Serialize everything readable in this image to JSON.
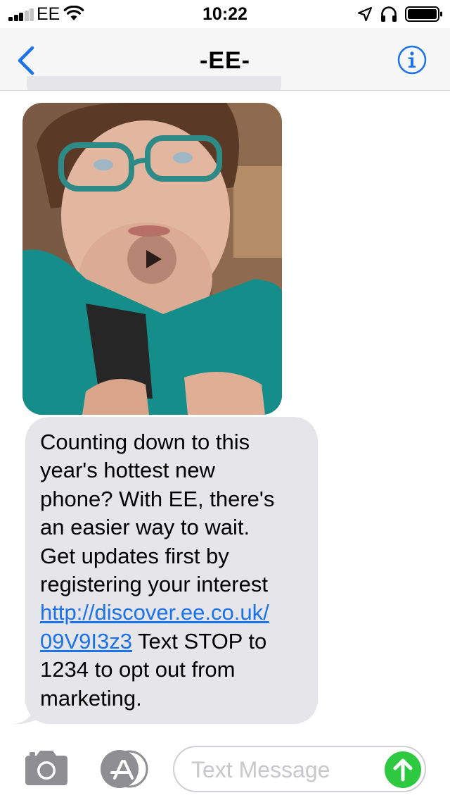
{
  "status_bar": {
    "carrier": "EE",
    "time": "10:22",
    "signal_bars_filled": 3,
    "signal_bars_total": 5
  },
  "nav": {
    "title": "-EE-",
    "back_icon": "chevron-left-icon",
    "info_icon": "info-icon"
  },
  "messages": {
    "video": {
      "play_icon": "play-icon"
    },
    "text_lines": [
      "Counting down to this",
      "year's hottest new",
      "phone? With EE, there's",
      "an easier way to wait.",
      "Get updates first by",
      "registering your interest"
    ],
    "link_part1": "http://discover.ee.co.uk/",
    "link_part2": "09V9I3z3",
    "after_link": " Text STOP to",
    "final_lines": [
      "1234 to opt out from",
      "marketing."
    ]
  },
  "input_bar": {
    "placeholder": "Text Message",
    "camera_icon": "camera-icon",
    "apps_icon": "app-store-icon",
    "send_icon": "send-arrow-icon"
  },
  "colors": {
    "accent": "#1a73e8",
    "bubble": "#e5e5ea",
    "send": "#2fc941"
  }
}
